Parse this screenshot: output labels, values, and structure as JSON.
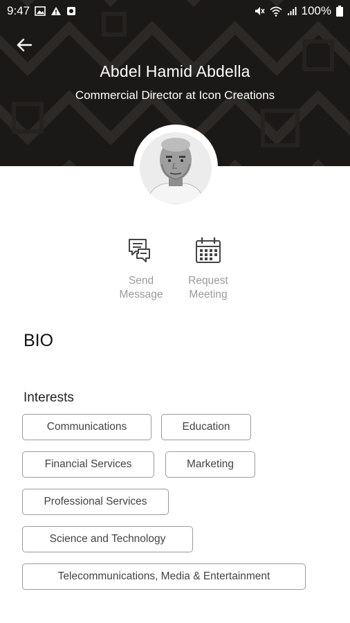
{
  "status_bar": {
    "time": "9:47",
    "left_icons": [
      "image-icon",
      "warning-icon",
      "app-notification-icon"
    ],
    "right_icons": [
      "mute-icon",
      "wifi-icon",
      "signal-icon"
    ],
    "battery": "100%"
  },
  "header": {
    "back_icon": "arrow-left-icon",
    "name": "Abdel Hamid Abdella",
    "title": "Commercial Director at Icon Creations"
  },
  "actions": [
    {
      "icon": "chat-bubbles-icon",
      "label": "Send\nMessage"
    },
    {
      "icon": "calendar-icon",
      "label": "Request\nMeeting"
    }
  ],
  "bio": {
    "heading": "BIO"
  },
  "interests": {
    "heading": "Interests",
    "chips": [
      "Communications",
      "Education",
      "Financial Services",
      "Marketing",
      "Professional Services",
      "Science and Technology",
      "Telecommunications, Media & Entertainment"
    ]
  }
}
